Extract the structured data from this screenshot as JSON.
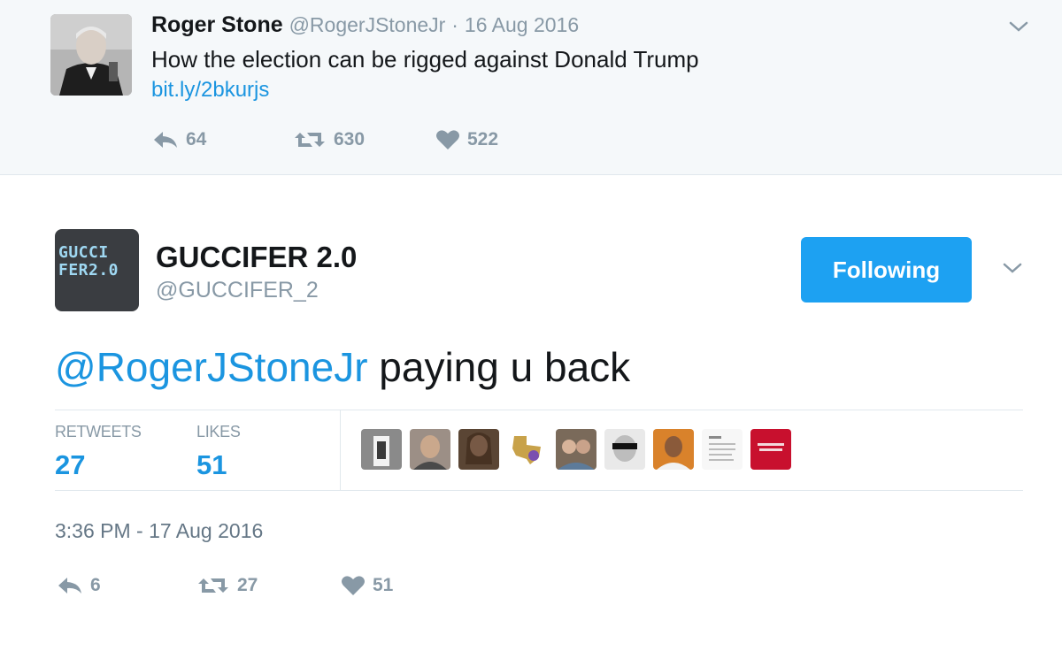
{
  "parent_tweet": {
    "author_name": "Roger Stone",
    "handle": "@RogerJStoneJr",
    "separator": "·",
    "date": "16 Aug 2016",
    "text": "How the election can be rigged against Donald Trump",
    "link": "bit.ly/2bkurjs",
    "replies": "64",
    "retweets": "630",
    "likes": "522"
  },
  "main_tweet": {
    "avatar_text_line1": "GUCCI",
    "avatar_text_line2": "FER2.0",
    "author_name": "GUCCIFER 2.0",
    "handle": "@GUCCIFER_2",
    "follow_label": "Following",
    "mention": "@RogerJStoneJr",
    "text": " paying u back",
    "retweets_label": "RETWEETS",
    "retweets_count": "27",
    "likes_label": "LIKES",
    "likes_count": "51",
    "timestamp": "3:36 PM - 17 Aug 2016",
    "replies": "6",
    "retweets": "27",
    "likes": "51"
  },
  "icons": {
    "reply": "reply-icon",
    "retweet": "retweet-icon",
    "like": "heart-icon",
    "more": "chevron-down-icon"
  },
  "colors": {
    "link_blue": "#1b95e0",
    "button_blue": "#1da1f2",
    "muted_gray": "#8899a6",
    "parent_bg": "#f5f8fa"
  }
}
